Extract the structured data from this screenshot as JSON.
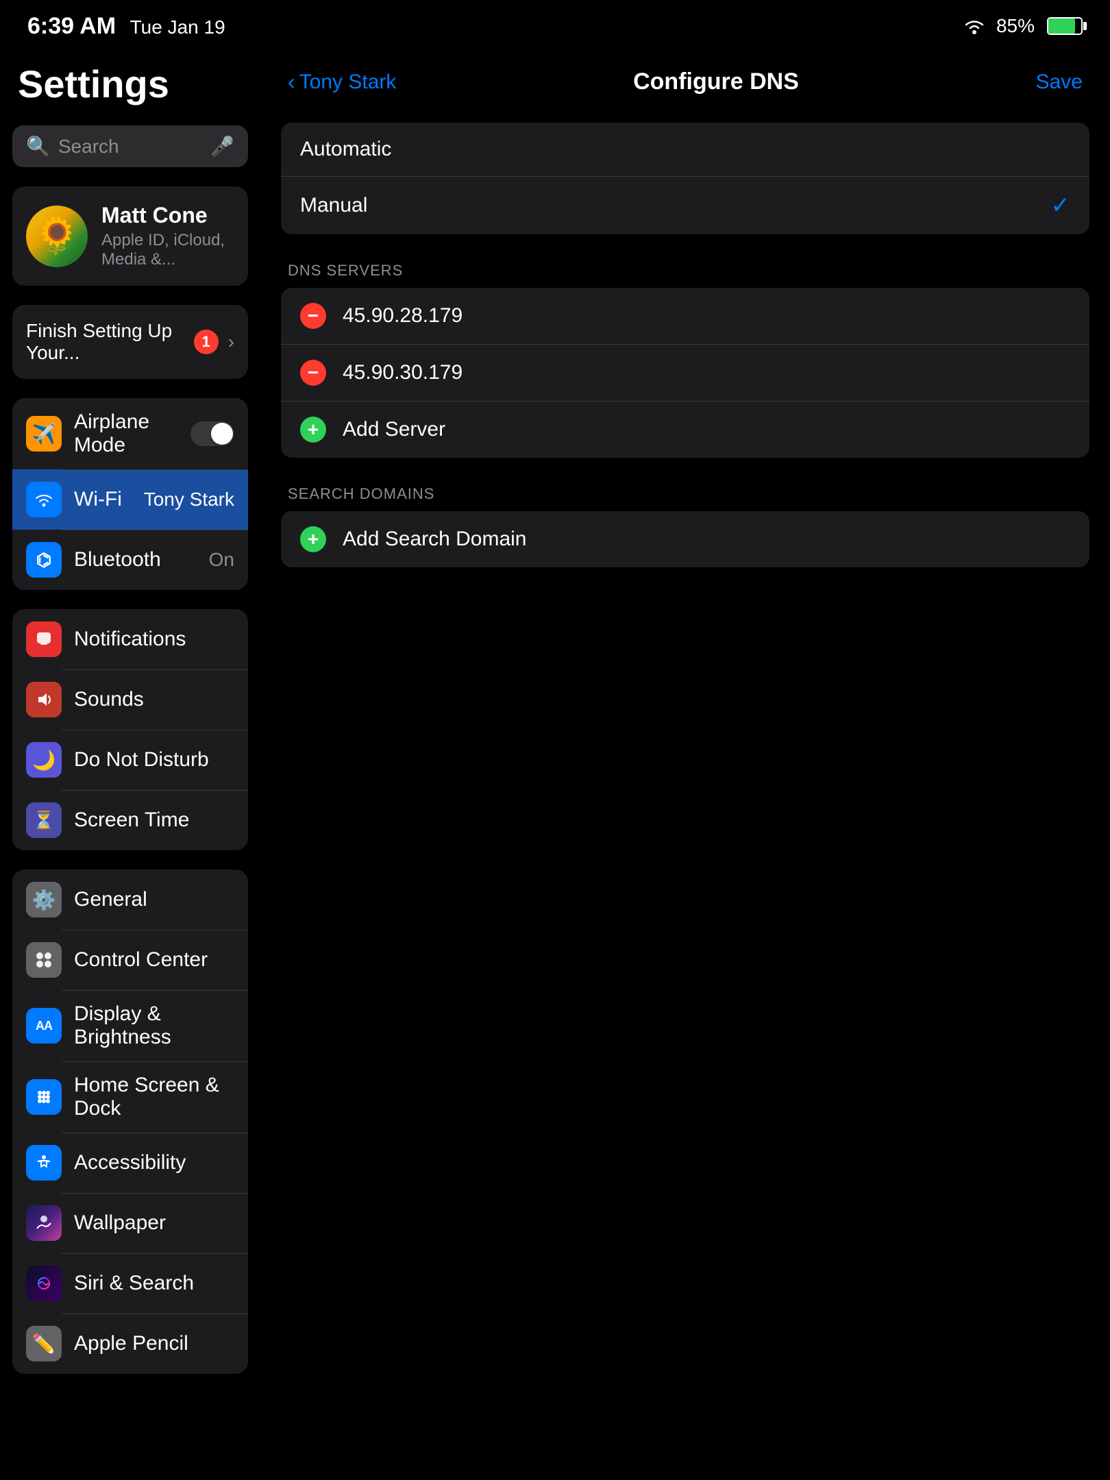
{
  "status_bar": {
    "time": "6:39 AM",
    "date": "Tue Jan 19",
    "battery_percent": "85%",
    "wifi_icon": "📶",
    "battery_icon": "🔋"
  },
  "sidebar": {
    "title": "Settings",
    "search": {
      "placeholder": "Search"
    },
    "profile": {
      "name": "Matt Cone",
      "subtitle": "Apple ID, iCloud, Media &...",
      "avatar_emoji": "🌻"
    },
    "finish_banner": {
      "text": "Finish Setting Up Your...",
      "badge": "1"
    },
    "groups": [
      {
        "id": "connectivity",
        "items": [
          {
            "id": "airplane-mode",
            "label": "Airplane Mode",
            "icon": "✈",
            "icon_class": "icon-orange",
            "has_toggle": true,
            "toggle_on": false
          },
          {
            "id": "wifi",
            "label": "Wi-Fi",
            "icon": "wifi",
            "icon_class": "icon-blue-light",
            "value": "Tony Stark",
            "selected": true
          },
          {
            "id": "bluetooth",
            "label": "Bluetooth",
            "icon": "bluetooth",
            "icon_class": "icon-blue",
            "value": "On"
          }
        ]
      },
      {
        "id": "system1",
        "items": [
          {
            "id": "notifications",
            "label": "Notifications",
            "icon": "🔴",
            "icon_class": "icon-red"
          },
          {
            "id": "sounds",
            "label": "Sounds",
            "icon": "🔊",
            "icon_class": "icon-red-sound"
          },
          {
            "id": "do-not-disturb",
            "label": "Do Not Disturb",
            "icon": "🌙",
            "icon_class": "icon-purple"
          },
          {
            "id": "screen-time",
            "label": "Screen Time",
            "icon": "⏳",
            "icon_class": "icon-indigo"
          }
        ]
      },
      {
        "id": "system2",
        "items": [
          {
            "id": "general",
            "label": "General",
            "icon": "⚙",
            "icon_class": "icon-gray"
          },
          {
            "id": "control-center",
            "label": "Control Center",
            "icon": "⊞",
            "icon_class": "icon-gray"
          },
          {
            "id": "display-brightness",
            "label": "Display & Brightness",
            "icon": "AA",
            "icon_class": "icon-aa",
            "is_text_icon": true
          },
          {
            "id": "home-screen-dock",
            "label": "Home Screen & Dock",
            "icon": "⊞",
            "icon_class": "icon-home"
          },
          {
            "id": "accessibility",
            "label": "Accessibility",
            "icon": "♿",
            "icon_class": "icon-accessibility"
          },
          {
            "id": "wallpaper",
            "label": "Wallpaper",
            "icon": "🏔",
            "icon_class": "icon-wallpaper"
          },
          {
            "id": "siri-search",
            "label": "Siri & Search",
            "icon": "◉",
            "icon_class": "icon-siri"
          },
          {
            "id": "apple-pencil",
            "label": "Apple Pencil",
            "icon": "✏",
            "icon_class": "icon-pencil"
          }
        ]
      }
    ]
  },
  "right_panel": {
    "nav": {
      "back_label": "Tony Stark",
      "title": "Configure DNS",
      "save_label": "Save"
    },
    "dns_modes": [
      {
        "id": "automatic",
        "label": "Automatic",
        "selected": false
      },
      {
        "id": "manual",
        "label": "Manual",
        "selected": true
      }
    ],
    "dns_servers_section_label": "DNS SERVERS",
    "dns_servers": [
      {
        "id": "server1",
        "address": "45.90.28.179",
        "removable": true
      },
      {
        "id": "server2",
        "address": "45.90.30.179",
        "removable": true
      }
    ],
    "add_server_label": "Add Server",
    "search_domains_section_label": "SEARCH DOMAINS",
    "add_search_domain_label": "Add Search Domain"
  }
}
